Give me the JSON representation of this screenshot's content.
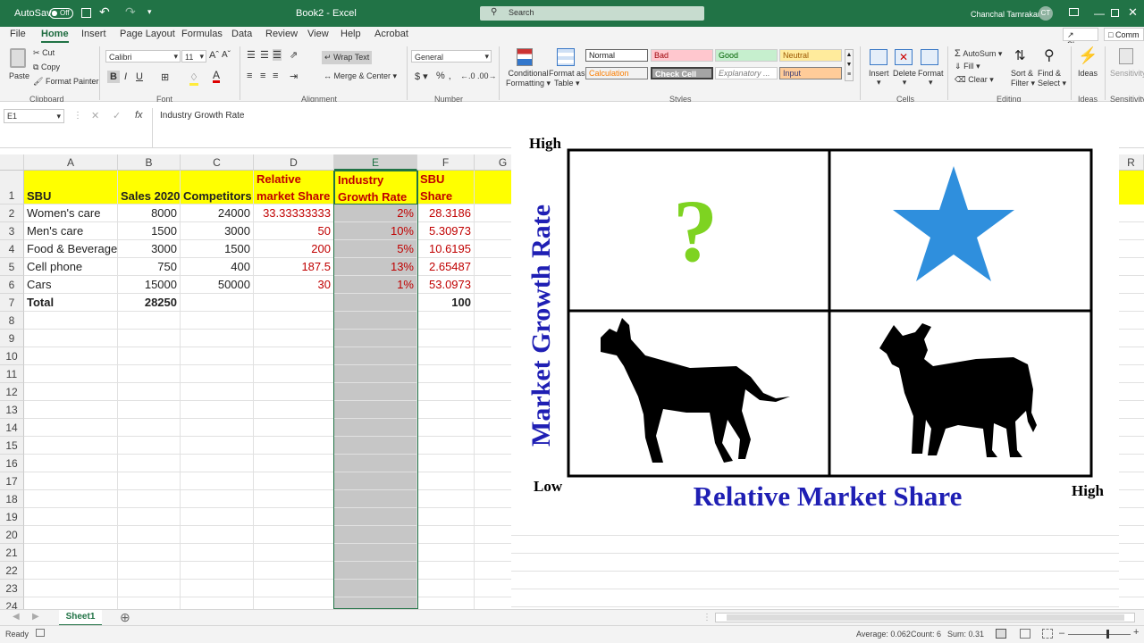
{
  "titlebar": {
    "autosave": "AutoSave",
    "autosave_state": "Off",
    "doc": "Book2 - Excel",
    "search": "Search",
    "user": "Chanchal Tamrakar",
    "initials": "CT"
  },
  "tabs": [
    "File",
    "Home",
    "Insert",
    "Page Layout",
    "Formulas",
    "Data",
    "Review",
    "View",
    "Help",
    "Acrobat"
  ],
  "share": "Share",
  "comments": "Comm",
  "ribbon": {
    "paste": "Paste",
    "cut": "Cut",
    "copy": "Copy",
    "format_painter": "Format Painter",
    "clipboard": "Clipboard",
    "font_name": "Calibri",
    "font_size": "11",
    "font_group": "Font",
    "wrap": "Wrap Text",
    "merge": "Merge & Center",
    "alignment": "Alignment",
    "numfmt": "General",
    "number": "Number",
    "cond": "Conditional",
    "cond2": "Formatting",
    "fmt_table": "Format as",
    "fmt_table2": "Table",
    "styles": "Styles",
    "style_normal": "Normal",
    "style_bad": "Bad",
    "style_good": "Good",
    "style_neutral": "Neutral",
    "style_calc": "Calculation",
    "style_check": "Check Cell",
    "style_expl": "Explanatory ...",
    "style_input": "Input",
    "insert": "Insert",
    "delete": "Delete",
    "format": "Format",
    "cells": "Cells",
    "autosum": "AutoSum",
    "fill": "Fill",
    "clear": "Clear",
    "sort": "Sort &",
    "sort2": "Filter",
    "find": "Find &",
    "find2": "Select",
    "editing": "Editing",
    "ideas": "Ideas",
    "ideas_grp": "Ideas",
    "sensitivity": "Sensitivity",
    "sensitivity_grp": "Sensitivity"
  },
  "formula": {
    "namebox": "E1",
    "fx": "fx",
    "content": "Industry Growth Rate"
  },
  "columns": [
    "A",
    "B",
    "C",
    "D",
    "E",
    "F",
    "G"
  ],
  "rows": [
    "1",
    "2",
    "3",
    "4",
    "5",
    "6",
    "7",
    "8",
    "9",
    "10",
    "11",
    "12",
    "13",
    "14",
    "15",
    "16",
    "17",
    "18",
    "19",
    "20",
    "21",
    "22",
    "23",
    "24"
  ],
  "col_r": "R",
  "table": {
    "headers": [
      "SBU",
      "Sales 2020",
      "Competitors",
      "Relative\nmarket Share",
      "Industry\nGrowth Rate",
      "SBU\nShare"
    ],
    "h_d1": "Relative",
    "h_d2": "market Share",
    "h_e1": "Industry",
    "h_e2": "Growth Rate",
    "h_f1": "SBU",
    "h_f2": "Share",
    "data": [
      [
        "Women's care",
        "8000",
        "24000",
        "33.33333333",
        "2%",
        "28.3186"
      ],
      [
        "Men's care",
        "1500",
        "3000",
        "50",
        "10%",
        "5.30973"
      ],
      [
        "Food & Beverage",
        "3000",
        "1500",
        "200",
        "5%",
        "10.6195"
      ],
      [
        "Cell phone",
        "750",
        "400",
        "187.5",
        "13%",
        "2.65487"
      ],
      [
        "Cars",
        "15000",
        "50000",
        "30",
        "1%",
        "53.0973"
      ]
    ],
    "total_label": "Total",
    "total_sales": "28250",
    "total_share": "100"
  },
  "matrix": {
    "high_top": "High",
    "low": "Low",
    "high_right": "High",
    "y_label": "Market Growth Rate",
    "x_label": "Relative Market Share",
    "question": "?",
    "accent_green": "#7ed321",
    "accent_blue": "#2f8fdd",
    "label_color": "#1f1fb4"
  },
  "sheet": "Sheet1",
  "status": {
    "ready": "Ready",
    "average": "Average: 0.062",
    "count": "Count: 6",
    "sum": "Sum: 0.31"
  }
}
